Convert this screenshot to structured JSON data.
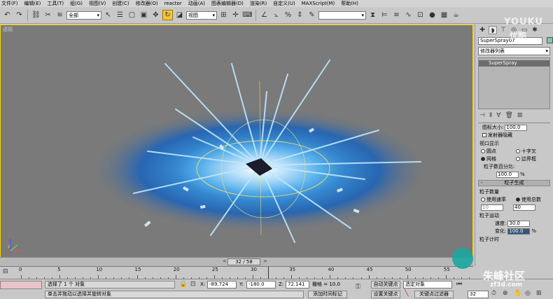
{
  "menu": [
    "文件(F)",
    "编辑(E)",
    "工具(T)",
    "组(G)",
    "视图(V)",
    "创建(C)",
    "修改器(O)",
    "reactor",
    "动画(A)",
    "图表编辑器(D)",
    "渲染(R)",
    "自定义(U)",
    "MAXScript(M)",
    "帮助(H)"
  ],
  "toolbar": {
    "selection_filter": "全部",
    "coord_system": "视图",
    "named_selection": ""
  },
  "viewport": {
    "label": "透视"
  },
  "panel": {
    "object_name": "SuperSpray07",
    "object_color": "#7ec8a8",
    "modifier_list": "修改器列表",
    "stack_entry": "SuperSpray",
    "icon_size_label": "图标大小:",
    "icon_size_value": "100.0",
    "emitter_hidden_label": "发射器隐藏",
    "viewport_display_group": "视口显示",
    "opt_dots": "圆点",
    "opt_ticks": "十字叉",
    "opt_mesh": "网格",
    "opt_bbox": "边界框",
    "percent_label": "粒子数百分比:",
    "percent_value": "100.0",
    "percent_unit": "%",
    "particle_gen_header": "粒子生成",
    "particle_qty_group": "粒子数量",
    "use_rate": "使用速率",
    "use_total": "使用总数",
    "rate_value": "10",
    "total_value": "40",
    "particle_motion_group": "粒子运动",
    "speed_label": "速度:",
    "speed_value": "30.0",
    "variation_label": "变化:",
    "variation_value": "100.0",
    "variation_unit": "%",
    "timing_group": "粒子计时"
  },
  "timeslider": {
    "frame_display": "32 / 58"
  },
  "track": {
    "ticks": [
      "0",
      "5",
      "10",
      "15",
      "20",
      "25",
      "30",
      "35",
      "40",
      "45",
      "50",
      "55"
    ],
    "current_frame": 32
  },
  "status": {
    "selection_info": "选择了 1 个 对象",
    "prompt": "单击并拖动以选择并旋转对象",
    "x_label": "X:",
    "x_value": "-89.724",
    "y_label": "Y:",
    "y_value": "-180.0",
    "z_label": "Z:",
    "z_value": "72.141",
    "grid_label": "栅格 = 10.0",
    "add_time_tag": "添加时间标记",
    "auto_key": "自动关键点",
    "set_key": "设置关键点",
    "key_filter_select": "选定对象",
    "key_filters": "关键点过滤器",
    "frame_field": "32"
  },
  "watermarks": {
    "youku": "YOUKU",
    "youku_cn": "优酷",
    "site_cn": "朱峰社区",
    "site_url": "zf3d.com"
  }
}
